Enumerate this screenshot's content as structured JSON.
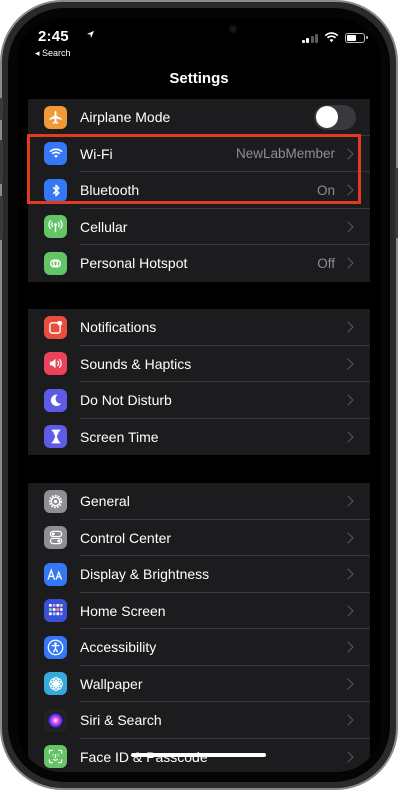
{
  "status_bar": {
    "time": "2:45",
    "back_label": "◂ Search"
  },
  "nav": {
    "title": "Settings"
  },
  "groups": [
    {
      "items": [
        {
          "label": "Airplane Mode",
          "icon": "airplane-icon",
          "icon_color": "#f09a37",
          "control": "toggle",
          "toggle_on": false
        },
        {
          "label": "Wi-Fi",
          "value": "NewLabMember",
          "icon": "wifi-icon",
          "icon_color": "#3478f6"
        },
        {
          "label": "Bluetooth",
          "value": "On",
          "icon": "bluetooth-icon",
          "icon_color": "#3478f6"
        },
        {
          "label": "Cellular",
          "icon": "cellular-icon",
          "icon_color": "#65c466"
        },
        {
          "label": "Personal Hotspot",
          "value": "Off",
          "icon": "hotspot-icon",
          "icon_color": "#65c466"
        }
      ]
    },
    {
      "items": [
        {
          "label": "Notifications",
          "icon": "notifications-icon",
          "icon_color": "#eb4d3d"
        },
        {
          "label": "Sounds & Haptics",
          "icon": "sounds-icon",
          "icon_color": "#eb445a"
        },
        {
          "label": "Do Not Disturb",
          "icon": "moon-icon",
          "icon_color": "#5e5ce6"
        },
        {
          "label": "Screen Time",
          "icon": "hourglass-icon",
          "icon_color": "#5e5ce6"
        }
      ]
    },
    {
      "items": [
        {
          "label": "General",
          "icon": "gear-icon",
          "icon_color": "#8e8e93"
        },
        {
          "label": "Control Center",
          "icon": "switches-icon",
          "icon_color": "#8e8e93"
        },
        {
          "label": "Display & Brightness",
          "icon": "aa-text-icon",
          "icon_color": "#3478f6"
        },
        {
          "label": "Home Screen",
          "icon": "app-grid-icon",
          "icon_color": "#3a50d9"
        },
        {
          "label": "Accessibility",
          "icon": "accessibility-icon",
          "icon_color": "#3478f6"
        },
        {
          "label": "Wallpaper",
          "icon": "flower-icon",
          "icon_color": "#36aadc"
        },
        {
          "label": "Siri & Search",
          "icon": "siri-icon",
          "icon_color": "#222222"
        },
        {
          "label": "Face ID & Passcode",
          "icon": "face-id-icon",
          "icon_color": "#65c466"
        }
      ]
    }
  ],
  "colors": {
    "background": "#000000",
    "group_background": "#1c1c1e",
    "highlight_border": "#e23a20"
  }
}
